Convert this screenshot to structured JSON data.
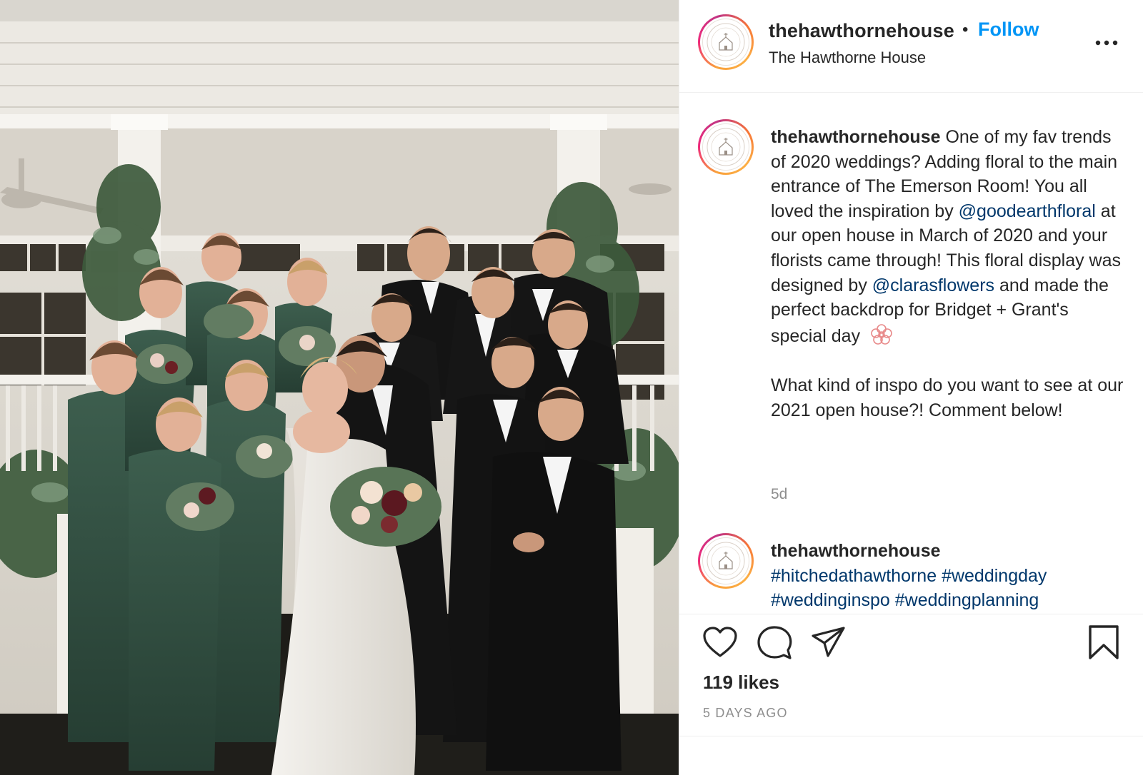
{
  "post": {
    "account": {
      "username": "thehawthornehouse",
      "display_name": "The Hawthorne House",
      "separator": "•",
      "follow_label": "Follow",
      "avatar_text": "HAWTHORNE HOUSE"
    },
    "caption": {
      "username": "thehawthornehouse",
      "part1": " One of my fav trends of 2020 weddings? Adding floral to the main entrance of The Emerson Room! You all loved the inspiration by ",
      "mention1": "@goodearthfloral",
      "part2": " at our open house in March of 2020 and your florists came through! This floral display was designed by ",
      "mention2": "@clarasflowers",
      "part3": " and made the perfect backdrop for Bridget + Grant's special day",
      "paragraph2": "What kind of inspo do you want to see at our 2021 open house?! Comment below!",
      "time": "5d"
    },
    "comment": {
      "username": "thehawthornehouse",
      "tags": "#hitchedathawthorne #weddingday #weddinginspo #weddingplanning"
    },
    "likes": "119 likes",
    "posted_ago": "5 DAYS AGO",
    "icons": {
      "like": "heart-icon",
      "comment": "comment-icon",
      "share": "share-icon",
      "save": "bookmark-icon",
      "more": "more-options-icon"
    },
    "colors": {
      "follow": "#0095f6",
      "mention": "#00376b",
      "muted": "#8e8e8e"
    }
  }
}
